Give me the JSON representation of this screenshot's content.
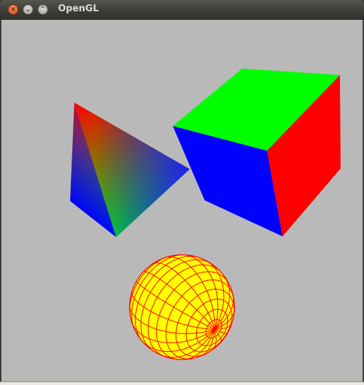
{
  "window": {
    "title": "OpenGL",
    "buttons": {
      "close_glyph": "×",
      "minimize_glyph": "⌄",
      "maximize_glyph": "⌃"
    }
  },
  "scene": {
    "background_color": "#b9b9b9",
    "objects": [
      {
        "name": "pyramid",
        "shading": "smooth",
        "vertex_colors": [
          "#ff0000",
          "#00ff00",
          "#0000ff"
        ]
      },
      {
        "name": "cube",
        "face_colors": {
          "top": "#00ff00",
          "front": "#0000ff",
          "right": "#ff0000"
        }
      },
      {
        "name": "sphere",
        "fill_color": "#ffff00",
        "wire_color": "#ff0000",
        "style": "wireframe"
      }
    ]
  }
}
